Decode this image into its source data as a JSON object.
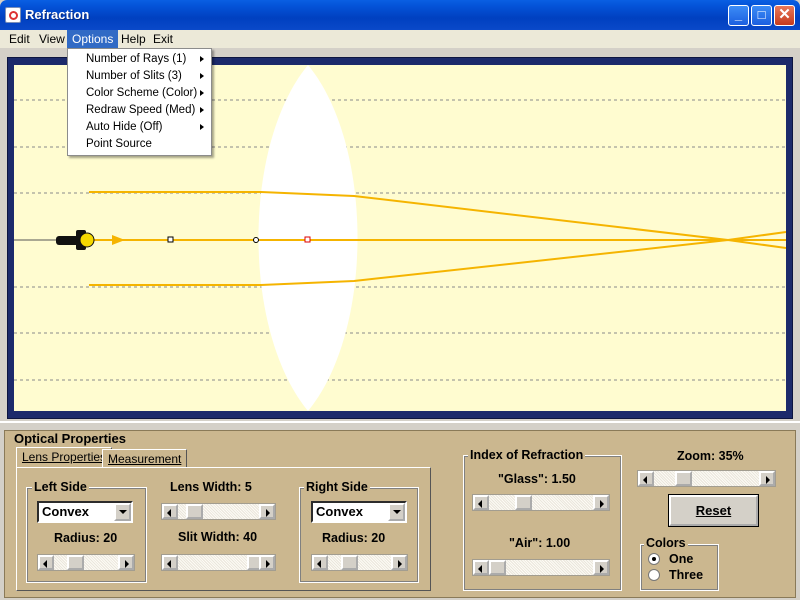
{
  "window": {
    "title": "Refraction"
  },
  "menubar": {
    "edit": "Edit",
    "view": "View",
    "options": "Options",
    "help": "Help",
    "exit": "Exit"
  },
  "options_menu": {
    "items": [
      "Number of Rays (1)",
      "Number of Slits (3)",
      "Color Scheme (Color)",
      "Redraw Speed (Med)",
      "Auto Hide (Off)",
      "Point Source"
    ]
  },
  "panel": {
    "title": "Optical Properties",
    "tabs": [
      "Lens Properties",
      "Measurement"
    ],
    "left_side": {
      "title": "Left Side",
      "shape": "Convex",
      "radius_label": "Radius: 20",
      "slider_fraction": 0.2
    },
    "lens_width": {
      "label": "Lens Width:  5",
      "slider_fraction": 0.1
    },
    "slit_width": {
      "label": "Slit Width: 40",
      "slider_fraction": 0.85
    },
    "right_side": {
      "title": "Right Side",
      "shape": "Convex",
      "radius_label": "Radius: 20",
      "slider_fraction": 0.2
    },
    "index_of_refraction": {
      "title": "Index of Refraction",
      "glass_label": "\"Glass\": 1.50",
      "glass_fraction": 0.25,
      "air_label": "\"Air\": 1.00",
      "air_fraction": 0.0
    },
    "zoom": {
      "label": "Zoom: 35%",
      "slider_fraction": 0.2
    },
    "reset_label": "Reset",
    "colors": {
      "title": "Colors",
      "options": [
        "One",
        "Three"
      ],
      "selected": "One"
    }
  },
  "colors": {
    "titlebar": "#0453d8",
    "canvas_bg": "#fffcd0",
    "ray": "#f5b400",
    "frame": "#1c2a6b",
    "panel_bg": "#cbb78f"
  }
}
